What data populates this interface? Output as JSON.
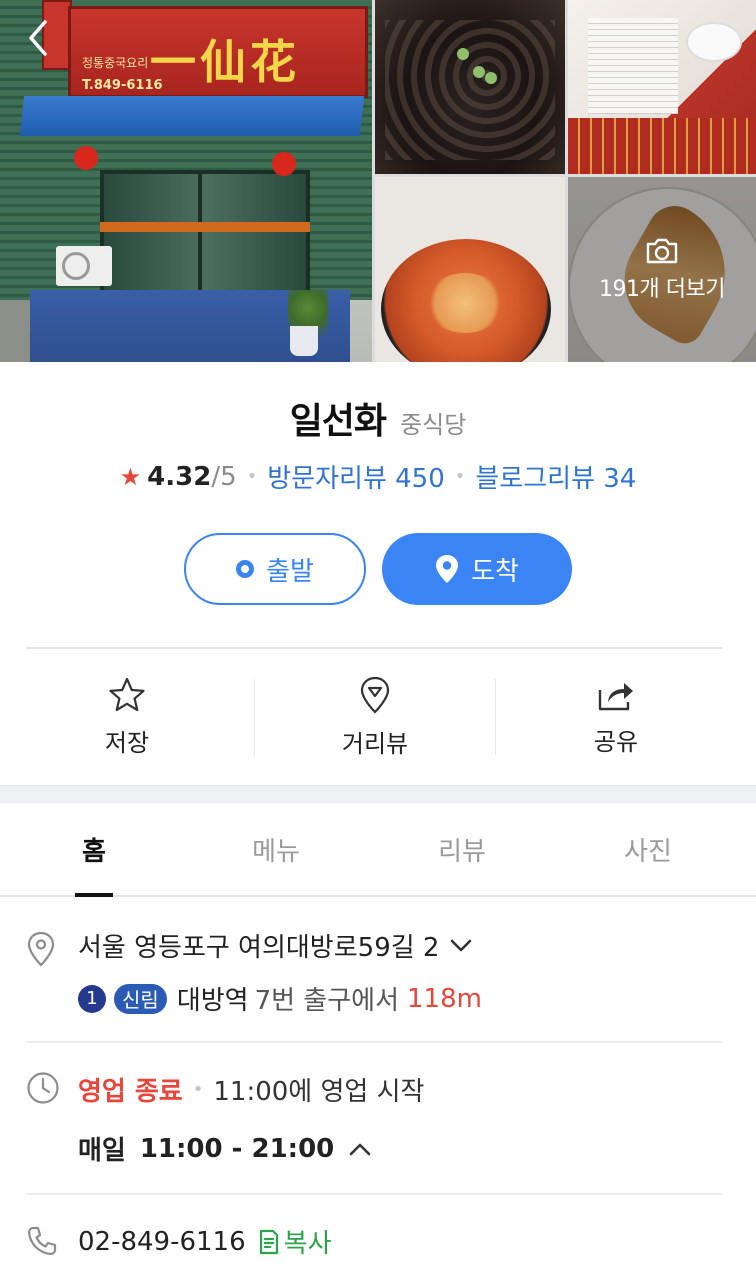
{
  "gallery": {
    "sign_hanja": "一仙花",
    "sign_sub": "정통중국요리",
    "sign_phone": "T.849-6116",
    "more_label": "191개 더보기"
  },
  "place": {
    "name": "일선화",
    "category": "중식당",
    "rating": "4.32",
    "rating_max": "/5",
    "visitor_reviews": "방문자리뷰 450",
    "blog_reviews": "블로그리뷰 34"
  },
  "route": {
    "start_label": "출발",
    "arrive_label": "도착"
  },
  "actions": [
    {
      "label": "저장",
      "icon": "star-icon"
    },
    {
      "label": "거리뷰",
      "icon": "street-view-icon"
    },
    {
      "label": "공유",
      "icon": "share-icon"
    }
  ],
  "tabs": [
    {
      "label": "홈",
      "active": true
    },
    {
      "label": "메뉴",
      "active": false
    },
    {
      "label": "리뷰",
      "active": false
    },
    {
      "label": "사진",
      "active": false
    }
  ],
  "address": {
    "text": "서울 영등포구 여의대방로59길 2",
    "line_number": "1",
    "line_name": "신림",
    "station": "대방역",
    "exit_text": "7번 출구에서",
    "distance": "118m"
  },
  "hours": {
    "status": "영업 종료",
    "next_open": "11:00에 영업 시작",
    "days": "매일",
    "range": "11:00 - 21:00"
  },
  "phone": {
    "number": "02-849-6116",
    "copy_label": "복사"
  },
  "colors": {
    "accent": "#3a84f3",
    "link": "#2f74d0",
    "alert": "#e8463b",
    "copy": "#2aa34a"
  }
}
